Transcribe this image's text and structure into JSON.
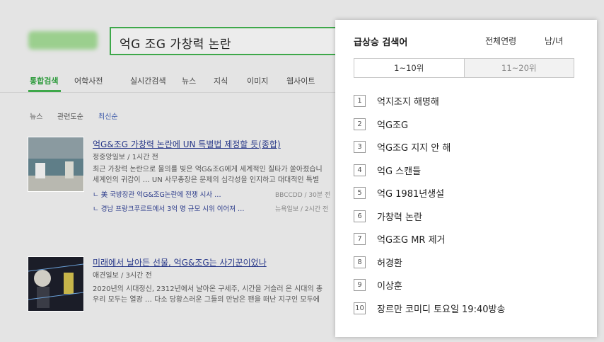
{
  "search": {
    "query": "억G 조G 가창력 논란"
  },
  "tabs": [
    "통합검색",
    "어학사전",
    "실시간검색",
    "뉴스",
    "지식",
    "이미지",
    "웹사이트"
  ],
  "filters": {
    "label": "뉴스",
    "sort1": "관련도순",
    "sort2": "최신순"
  },
  "news": [
    {
      "title": "억G&조G 가창력 논란에 UN 특별법 제정할 듯(종합)",
      "meta": "정중앙일보 / 1시간 전",
      "body1": "최근 가창력 논란으로 물의를 빚은 억G&조G에게 세계적인 질타가 쏟아졌습니",
      "body2": "세계인의 귀감이 … UN 사무총장은 문제의 심각성을 인지하고 대대적인 특별",
      "sub1": "ㄴ 美 국방장관 억G&조G논란에 전쟁 시사 …",
      "sub1_meta": "BBCCDD / 30분 전",
      "sub2": "ㄴ 경남 프랑크푸르트에서 3억 명 규모 시위 이어져 …",
      "sub2_meta": "뉴욕일보 / 2시간 전"
    },
    {
      "title": "미래에서 날아든 선물, 억G&조G는 사기꾼이었나",
      "meta": "애견일보 / 3시간 전",
      "body1": "2020년의 시대정신, 2312년에서 날아온 구세주, 시간을 거슬러 온 시대의 총",
      "body2": "우리 모두는 열광 … 다소 당황스러운 그들의 만남은 팬을 떠난 지구인 모두에"
    }
  ],
  "popup": {
    "title": "급상승 검색어",
    "age": "전체연령",
    "gender": "남/녀",
    "range_tabs": [
      "1~10위",
      "11~20위"
    ],
    "ranks": [
      {
        "num": "1",
        "text": "억지조지 해명해"
      },
      {
        "num": "2",
        "text": "억G조G"
      },
      {
        "num": "3",
        "text": "억G조G 지지 안 해"
      },
      {
        "num": "4",
        "text": "억G 스캔들"
      },
      {
        "num": "5",
        "text": "억G 1981년생설"
      },
      {
        "num": "6",
        "text": "가창력 논란"
      },
      {
        "num": "7",
        "text": "억G조G MR 제거"
      },
      {
        "num": "8",
        "text": "허경환"
      },
      {
        "num": "9",
        "text": "이상훈"
      },
      {
        "num": "10",
        "text": "장르만 코미디 토요일 19:40방송"
      }
    ]
  }
}
